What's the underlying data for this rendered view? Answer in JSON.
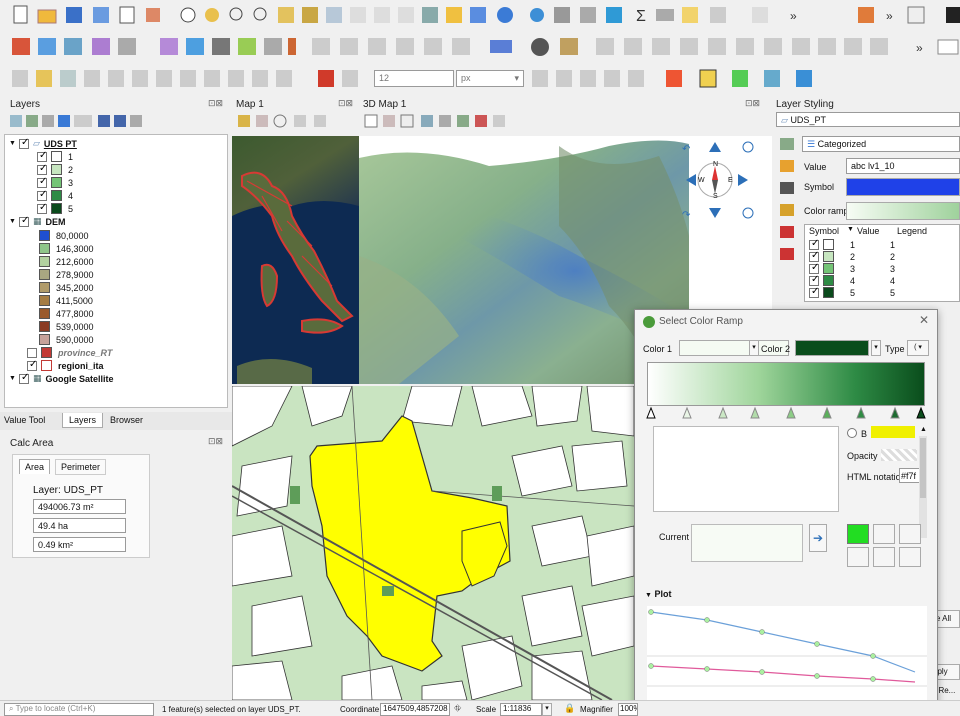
{
  "panels": {
    "layers_title": "Layers",
    "map1_title": "Map 1",
    "map3d_title": "3D Map 1",
    "styling_title": "Layer Styling",
    "styling_layer": "UDS_PT",
    "renderer": "Categorized"
  },
  "layers": {
    "uds_name": "UDS PT",
    "uds_classes": [
      "1",
      "2",
      "3",
      "4",
      "5"
    ],
    "uds_colors": [
      "#ffffff",
      "#c7e6c0",
      "#74c476",
      "#2e8b45",
      "#0b4a1c"
    ],
    "dem_name": "DEM",
    "dem_values": [
      "80,0000",
      "146,3000",
      "212,6000",
      "278,9000",
      "345,2000",
      "411,5000",
      "477,8000",
      "539,0000",
      "590,0000"
    ],
    "dem_colors": [
      "#1f4fd1",
      "#8fc58a",
      "#b2d1a0",
      "#a8a681",
      "#b09b6a",
      "#a57d44",
      "#9a5a2b",
      "#8b3b22",
      "#c7a29a"
    ],
    "province": "province_RT",
    "regioni": "regioni_ita",
    "satellite": "Google Satellite"
  },
  "bottom_tabs": [
    "Value Tool",
    "Layers",
    "Browser"
  ],
  "calc": {
    "title": "Calc Area",
    "tab_area": "Area",
    "tab_perimeter": "Perimeter",
    "layer_label": "Layer: UDS_PT",
    "m2": "494006.73 m²",
    "ha": "49.4 ha",
    "km2": "0.49 km²"
  },
  "styling": {
    "value_label": "Value",
    "value_field": "abc lv1_10",
    "symbol_label": "Symbol",
    "ramp_label": "Color ramp",
    "col_symbol": "Symbol",
    "col_value": "Value",
    "col_legend": "Legend",
    "rows": [
      {
        "v": "1",
        "l": "1"
      },
      {
        "v": "2",
        "l": "2"
      },
      {
        "v": "3",
        "l": "3"
      },
      {
        "v": "4",
        "l": "4"
      },
      {
        "v": "5",
        "l": "5"
      }
    ],
    "delete_all": "elete All",
    "apply": "pply",
    "apply2": "fy Re..."
  },
  "dialog": {
    "title": "Select Color Ramp",
    "color1": "Color 1",
    "color2": "Color 2",
    "type": "Type",
    "opacity": "Opacity",
    "html_notation": "HTML notation",
    "html_value": "#f7f",
    "current": "Current",
    "plot": "Plot",
    "b_label": "B"
  },
  "compass": {
    "n": "N",
    "s": "S",
    "e": "E",
    "w": "W"
  },
  "toolbar": {
    "font_size": "12",
    "unit": "px"
  },
  "status": {
    "search_placeholder": "Type to locate (Ctrl+K)",
    "message": "1 feature(s) selected on layer UDS_PT.",
    "coord_label": "Coordinate",
    "coord": "1647509,4857208",
    "scale_label": "Scale",
    "scale": "1:11836",
    "magnifier_label": "Magnifier",
    "magnifier": "100%"
  }
}
